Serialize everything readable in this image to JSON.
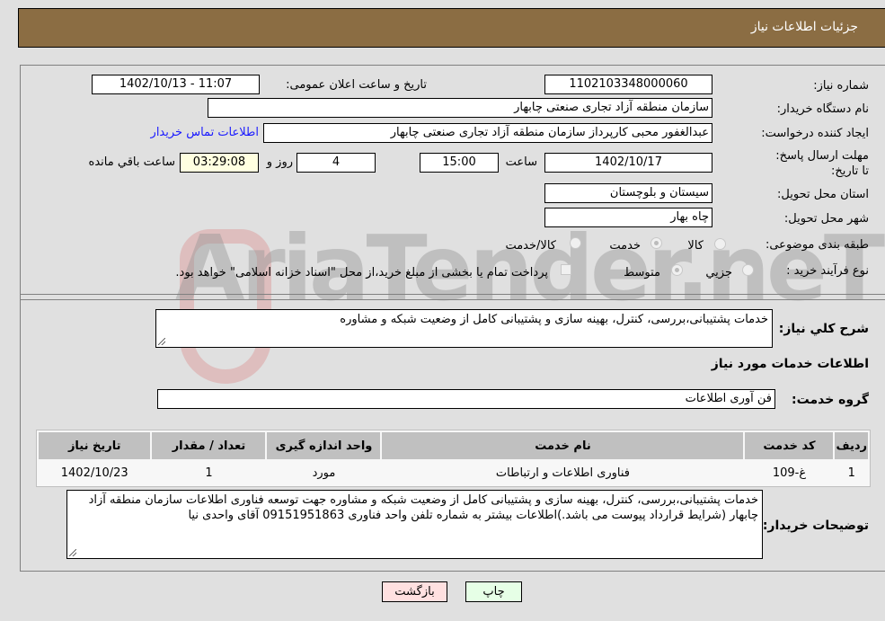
{
  "header": {
    "title": "جزئیات اطلاعات نیاز"
  },
  "form": {
    "need_number": {
      "label": "شماره نیاز:",
      "value": "1102103348000060"
    },
    "announce_datetime": {
      "label": "تاریخ و ساعت اعلان عمومی:",
      "value": "1402/10/13 - 11:07"
    },
    "buyer_org": {
      "label": "نام دستگاه خریدار:",
      "value": "سازمان منطقه آزاد تجاری صنعتی چابهار"
    },
    "requester": {
      "label": "ایجاد کننده درخواست:",
      "value": "عبدالغفور محبی کارپرداز سازمان منطقه آزاد تجاری صنعتی چابهار"
    },
    "buyer_contact_link": "اطلاعات تماس خریدار",
    "deadline": {
      "label": "مهلت ارسال پاسخ: تا تاریخ:",
      "date": "1402/10/17",
      "time_label": "ساعت",
      "time": "15:00",
      "days": "4",
      "days_label": "روز و",
      "remaining": "03:29:08",
      "remaining_label": "ساعت باقي مانده"
    },
    "province": {
      "label": "استان محل تحویل:",
      "value": "سیستان و بلوچستان"
    },
    "city": {
      "label": "شهر محل تحویل:",
      "value": "چاه بهار"
    },
    "category": {
      "label": "طبقه بندی موضوعی:",
      "options": [
        "کالا",
        "خدمت",
        "کالا/خدمت"
      ],
      "selected": "خدمت"
    },
    "purchase_process": {
      "label": "نوع فرآیند خرید :",
      "options": [
        "جزیي",
        "متوسط"
      ],
      "selected": "متوسط",
      "treasury_note": "پرداخت تمام یا بخشی از مبلغ خرید،از محل \"اسناد خزانه اسلامی\" خواهد بود."
    },
    "general_description": {
      "label": "شرح کلي نیاز:",
      "value": "خدمات پشتیبانی،بررسی، کنترل، بهینه سازی و پشتیبانی کامل از وضعیت شبکه و مشاوره"
    },
    "services_section_title": "اطلاعات خدمات مورد نیاز",
    "service_group": {
      "label": "گروه خدمت:",
      "value": "فن آوری اطلاعات"
    }
  },
  "table": {
    "headers": [
      "ردیف",
      "کد خدمت",
      "نام خدمت",
      "واحد اندازه گیری",
      "تعداد / مقدار",
      "تاریخ نیاز"
    ],
    "rows": [
      [
        "1",
        "غ-109",
        "فناوری اطلاعات و ارتباطات",
        "مورد",
        "1",
        "1402/10/23"
      ]
    ]
  },
  "buyer_notes": {
    "label": "توضیحات خریدار:",
    "value": "خدمات پشتیبانی،بررسی، کنترل، بهینه سازی و پشتیبانی کامل از وضعیت شبکه و مشاوره جهت توسعه فناوری اطلاعات سازمان منطقه آزاد چابهار (شرایط قرارداد پیوست می باشد.)اطلاعات بیشتر به شماره تلفن واحد فناوری 09151951863 آقای واحدی نیا"
  },
  "buttons": {
    "print": "چاپ",
    "back": "بازگشت"
  },
  "watermark": "AriaTender.neT"
}
